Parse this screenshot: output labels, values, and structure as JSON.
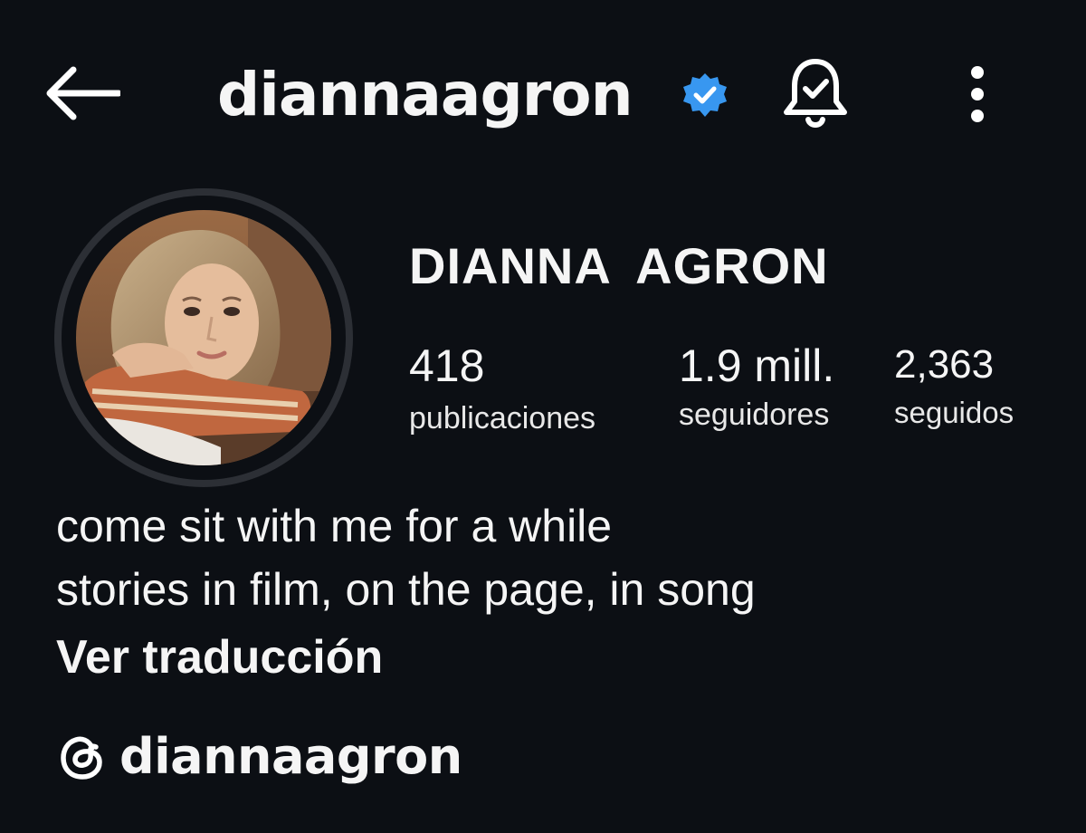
{
  "header": {
    "username": "diannaagron",
    "back_icon": "arrow-left-icon",
    "verified_icon": "verified-badge-icon",
    "notifications_icon": "bell-check-icon",
    "more_icon": "more-vertical-icon"
  },
  "profile": {
    "full_name": "DIANNA  AGRON",
    "stats": {
      "posts": {
        "count": "418",
        "label": "publicaciones"
      },
      "followers": {
        "count": "1.9 mill.",
        "label": "seguidores"
      },
      "following": {
        "count": "2,363",
        "label": "seguidos"
      }
    },
    "bio": {
      "lines": [
        "come sit with me for a while",
        "stories in film, on the page, in song"
      ],
      "translate_label": "Ver traducción"
    },
    "threads": {
      "icon": "threads-icon",
      "handle": "diannaagron"
    }
  },
  "colors": {
    "background": "#0c0f14",
    "text": "#f5f5f5",
    "verified": "#3897f0",
    "avatar_ring": "#2c2f35"
  }
}
